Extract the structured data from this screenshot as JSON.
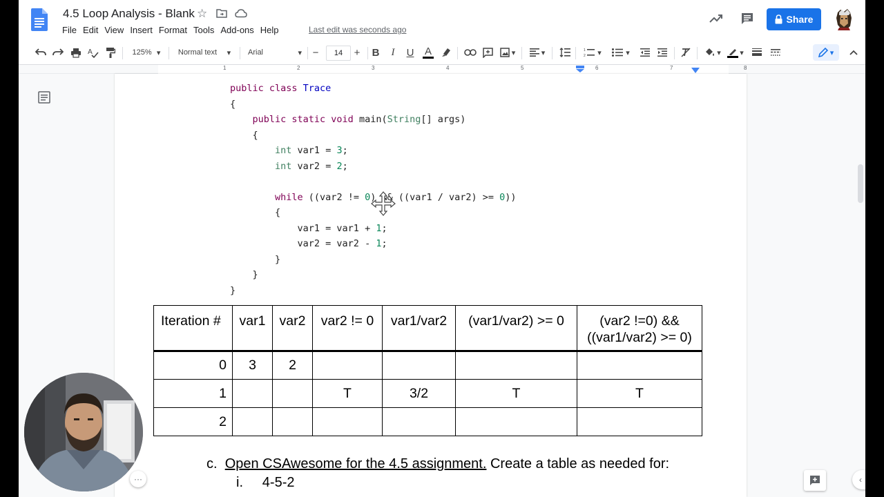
{
  "app": {
    "title": "4.5 Loop Analysis - Blank",
    "last_edit": "Last edit was seconds ago",
    "share_label": "Share",
    "menu": [
      "File",
      "Edit",
      "View",
      "Insert",
      "Format",
      "Tools",
      "Add-ons",
      "Help"
    ]
  },
  "toolbar": {
    "zoom": "125%",
    "style": "Normal text",
    "font": "Arial",
    "font_size": "14",
    "minus": "−",
    "plus": "+",
    "bold": "B",
    "italic": "I",
    "underline": "U",
    "text_color": "A"
  },
  "ruler": {
    "numbers": [
      "1",
      "2",
      "3",
      "4",
      "5",
      "6",
      "7",
      "8"
    ]
  },
  "code": {
    "lines": [
      [
        {
          "t": "public class ",
          "c": "kw"
        },
        {
          "t": "Trace",
          "c": "cls"
        }
      ],
      [
        {
          "t": "{",
          "c": ""
        }
      ],
      [
        {
          "t": "    public static void ",
          "c": "kw"
        },
        {
          "t": "main(",
          "c": ""
        },
        {
          "t": "String",
          "c": "kwb"
        },
        {
          "t": "[] args)",
          "c": ""
        }
      ],
      [
        {
          "t": "    {",
          "c": ""
        }
      ],
      [
        {
          "t": "        ",
          "c": ""
        },
        {
          "t": "int",
          "c": "kwb"
        },
        {
          "t": " var1 = ",
          "c": ""
        },
        {
          "t": "3",
          "c": "num"
        },
        {
          "t": ";",
          "c": ""
        }
      ],
      [
        {
          "t": "        ",
          "c": ""
        },
        {
          "t": "int",
          "c": "kwb"
        },
        {
          "t": " var2 = ",
          "c": ""
        },
        {
          "t": "2",
          "c": "num"
        },
        {
          "t": ";",
          "c": ""
        }
      ],
      [
        {
          "t": "",
          "c": ""
        }
      ],
      [
        {
          "t": "        ",
          "c": ""
        },
        {
          "t": "while",
          "c": "kw"
        },
        {
          "t": " ((var2 != ",
          "c": ""
        },
        {
          "t": "0",
          "c": "num"
        },
        {
          "t": ") && ((var1 / var2) >= ",
          "c": ""
        },
        {
          "t": "0",
          "c": "num"
        },
        {
          "t": "))",
          "c": ""
        }
      ],
      [
        {
          "t": "        {",
          "c": ""
        }
      ],
      [
        {
          "t": "            var1 = var1 + ",
          "c": ""
        },
        {
          "t": "1",
          "c": "num"
        },
        {
          "t": ";",
          "c": ""
        }
      ],
      [
        {
          "t": "            var2 = var2 - ",
          "c": ""
        },
        {
          "t": "1",
          "c": "num"
        },
        {
          "t": ";",
          "c": ""
        }
      ],
      [
        {
          "t": "        }",
          "c": ""
        }
      ],
      [
        {
          "t": "    }",
          "c": ""
        }
      ],
      [
        {
          "t": "}",
          "c": ""
        }
      ]
    ]
  },
  "table": {
    "headers": [
      "Iteration #",
      "var1",
      "var2",
      "var2 != 0",
      "var1/var2",
      "(var1/var2) >= 0",
      "(var2 !=0) &&\n((var1/var2) >= 0)"
    ],
    "rows": [
      [
        "0",
        "3",
        "2",
        "",
        "",
        "",
        ""
      ],
      [
        "1",
        "",
        "",
        "T",
        "3/2",
        "T",
        "T"
      ],
      [
        "2",
        "",
        "",
        "",
        "",
        "",
        ""
      ]
    ]
  },
  "list": {
    "c_marker": "c.",
    "c_link": "Open CSAwesome for the 4.5 assignment.",
    "c_rest": " Create a table as needed for:",
    "i_marker": "i.",
    "i_text": "4-5-2"
  },
  "colors": {
    "share": "#1a73e8",
    "docs_blue": "#4285f4"
  }
}
